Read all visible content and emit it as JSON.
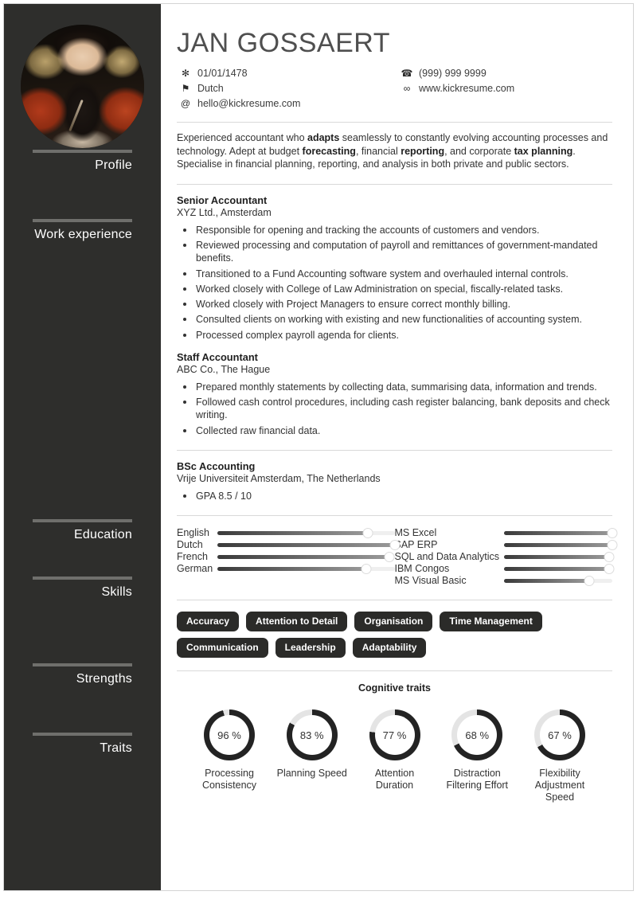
{
  "sidebar": {
    "avatar_alt": "portrait-photo",
    "sections": [
      {
        "label": "Profile"
      },
      {
        "label": "Work experience"
      },
      {
        "label": "Education"
      },
      {
        "label": "Skills"
      },
      {
        "label": "Strengths"
      },
      {
        "label": "Traits"
      }
    ]
  },
  "header": {
    "name": "JAN GOSSAERT",
    "contacts_left": [
      {
        "icon": "sun-icon",
        "glyph": "✻",
        "text": "01/01/1478"
      },
      {
        "icon": "flag-icon",
        "glyph": "⚑",
        "text": "Dutch"
      },
      {
        "icon": "at-icon",
        "glyph": "@",
        "text": "hello@kickresume.com"
      }
    ],
    "contacts_right": [
      {
        "icon": "phone-icon",
        "glyph": "☎",
        "text": "(999) 999 9999"
      },
      {
        "icon": "link-icon",
        "glyph": "∞",
        "text": "www.kickresume.com"
      }
    ]
  },
  "profile": {
    "parts": [
      {
        "text": "Experienced accountant who ",
        "bold": false
      },
      {
        "text": "adapts",
        "bold": true
      },
      {
        "text": " seamlessly to constantly evolving accounting processes and technology. Adept at budget ",
        "bold": false
      },
      {
        "text": "forecasting",
        "bold": true
      },
      {
        "text": ", financial ",
        "bold": false
      },
      {
        "text": "reporting",
        "bold": true
      },
      {
        "text": ", and corporate ",
        "bold": false
      },
      {
        "text": "tax planning",
        "bold": true
      },
      {
        "text": ". Specialise in financial planning, reporting, and analysis in both private and public sectors.",
        "bold": false
      }
    ]
  },
  "work_experience": [
    {
      "title": "Senior Accountant",
      "subtitle": "XYZ Ltd., Amsterdam",
      "bullets": [
        "Responsible for opening and tracking the accounts of customers and vendors.",
        "Reviewed processing and computation of payroll and remittances of government-mandated benefits.",
        "Transitioned to a Fund Accounting software system and overhauled internal controls.",
        "Worked closely with College of Law Administration on special, fiscally-related tasks.",
        "Worked closely with Project Managers to ensure correct monthly billing.",
        "Consulted clients on working with existing and new functionalities of accounting system.",
        "Processed complex payroll agenda for clients."
      ]
    },
    {
      "title": "Staff Accountant",
      "subtitle": "ABC Co., The Hague",
      "bullets": [
        "Prepared monthly statements by collecting data, summarising data, information and trends.",
        "Followed cash control procedures, including cash register balancing, bank deposits and check writing.",
        "Collected raw financial data."
      ]
    }
  ],
  "education": [
    {
      "title": "BSc Accounting",
      "subtitle": "Vrije Universiteit Amsterdam, The Netherlands",
      "bullets": [
        "GPA 8.5 / 10"
      ]
    }
  ],
  "skills": {
    "languages": [
      {
        "name": "English",
        "level": 85
      },
      {
        "name": "Dutch",
        "level": 100
      },
      {
        "name": "French",
        "level": 97
      },
      {
        "name": "German",
        "level": 84
      }
    ],
    "software": [
      {
        "name": "MS Excel",
        "level": 100
      },
      {
        "name": "SAP ERP",
        "level": 100
      },
      {
        "name": "SQL and Data Analytics",
        "level": 97
      },
      {
        "name": "IBM Congos",
        "level": 97
      },
      {
        "name": "MS Visual Basic",
        "level": 79
      }
    ]
  },
  "strengths": [
    "Accuracy",
    "Attention to Detail",
    "Organisation",
    "Time Management",
    "Communication",
    "Leadership",
    "Adaptability"
  ],
  "traits": {
    "title": "Cognitive traits",
    "items": [
      {
        "label": "Processing Consistency",
        "value": 96,
        "display": "96 %"
      },
      {
        "label": "Planning Speed",
        "value": 83,
        "display": "83 %"
      },
      {
        "label": "Attention Duration",
        "value": 77,
        "display": "77 %"
      },
      {
        "label": "Distraction Filtering Effort",
        "value": 68,
        "display": "68 %"
      },
      {
        "label": "Flexibility Adjustment Speed",
        "value": 67,
        "display": "67 %"
      }
    ]
  },
  "colors": {
    "sidebar_bg": "#2e2e2c",
    "tag_bg": "#2b2b29",
    "accent_dark": "#333333",
    "rule": "#6f6f6c",
    "track": "#efefef"
  }
}
